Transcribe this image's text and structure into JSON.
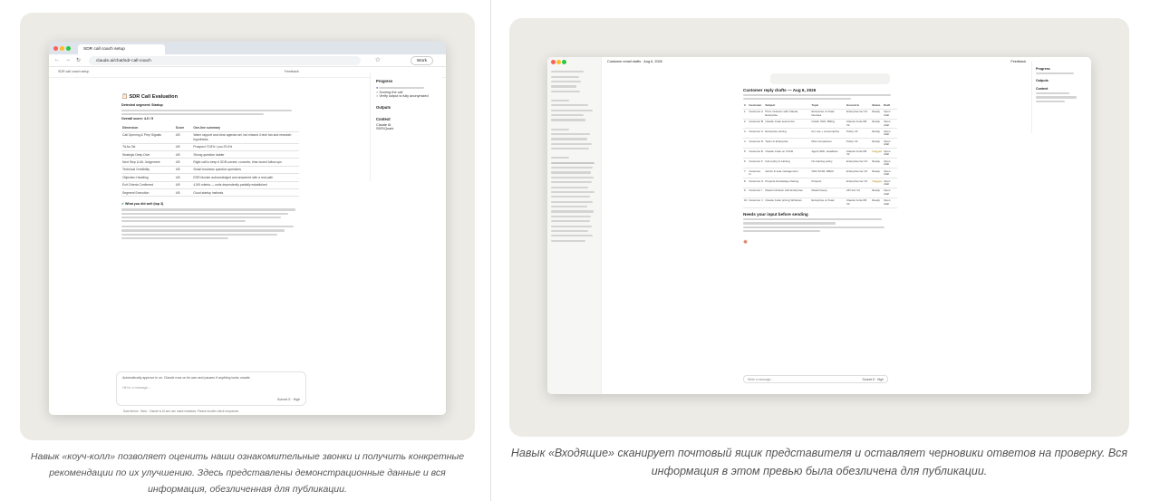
{
  "captions": {
    "left": "Навык «коуч-колл» позволяет оценить наши ознакомительные звонки и получить конкретные рекомендации по их улучшению. Здесь представлены демонстрационные данные и вся информация, обезличенная для публикации.",
    "right": "Навык «Входящие» сканирует почтовый ящик представителя и оставляет черновики ответов на проверку. Вся информация в этом превью была обезличена для публикации."
  },
  "left_shot": {
    "tab_title": "SDR call coach setup",
    "url": "claude.ai/chat/sdr-call-coach",
    "work_label": "Work",
    "toolbar_title": "SDR call coach setup",
    "feedback": "Feedback",
    "doc_title": "SDR Call Evaluation",
    "segment_line": "Detected segment: Startup",
    "overall": "Overall score: 4.0 / 5",
    "table_headers": [
      "Dimension",
      "Score",
      "One-line summary"
    ],
    "table_rows": [
      [
        "Call Opening & Prep Signals",
        "4/5",
        "Warm rapport and clear agenda set, but missed 4 tech fan and research hypothesis"
      ],
      [
        "Tit-for-Tat",
        "4/5",
        "Prospect 70.8% / you 29.4%"
      ],
      [
        "Strategic Deep Dive",
        "4/5",
        "Strong question ladder"
      ],
      [
        "Next Step & Alt. Judgement",
        "4/5",
        "Right call to keep it SDR-owned; concrete, time-boxed follow ups"
      ],
      [
        "Technical Credibility",
        "4/5",
        "Smart business question questions"
      ],
      [
        "Objection Handling",
        "4/5",
        "EDR blocker acknowledged and answered with a real path"
      ],
      [
        "Exit Criteria Confirmed",
        "4/5",
        "4.5/5 criteria — units dependently partially established"
      ],
      [
        "Segment Execution",
        "4/5",
        "Good startup instincts"
      ]
    ],
    "did_well": "What you did well (top 3)",
    "progress_title": "Progress",
    "progress_items": [
      "Scoring the call",
      "Verify output is fully anonymized"
    ],
    "outputs": "Outputs",
    "context": "Context",
    "context_items": [
      "Claude AI",
      "SDR/Quark"
    ],
    "notice": "Automatically approve is on. Claude runs on its own and pauses if anything looks unsafe.",
    "input_placeholder": "Hit for a message…",
    "model": "Sonnet 5 · High",
    "footer": [
      "Dark theme",
      "Beta",
      "Claude is AI and can make mistakes. Please double-check responses."
    ]
  },
  "right_shot": {
    "header_title": "Customer email drafts · Aug 6, 2026",
    "feedback": "Feedback",
    "section_title": "Customer reply drafts — Aug 6, 2026",
    "table_headers": [
      "#",
      "Customer",
      "Subject",
      "Topic",
      "Ground in",
      "Status",
      "Draft"
    ],
    "table_rows": [
      [
        "1",
        "Customer A",
        "Price inclusion with Claude Enterprise",
        "Enterprise vs Team licenses",
        "Enterprise tier V2",
        "Ready",
        "Open draft"
      ],
      [
        "2",
        "Customer B",
        "Claude Code seat terms",
        "Install, SSO, Billing",
        "Claude Code KB V2",
        "Ready",
        "Open draft"
      ],
      [
        "3",
        "Customer C",
        "Enterprise pricing",
        "For use + consumption",
        "Policy V2",
        "Ready",
        "Open draft"
      ],
      [
        "4",
        "Customer D",
        "Team to Enterprise",
        "Plan comparison",
        "Policy V2",
        "Ready",
        "Open draft"
      ],
      [
        "5",
        "Customer E",
        "Claude Code on CI/CD",
        "Agent SDK, Headless",
        "Claude Code KB V2",
        "Flagged",
        "Open draft"
      ],
      [
        "6",
        "Customer F",
        "Fair policy & training",
        "No training policy",
        "Enterprise tier V2",
        "Ready",
        "Open draft"
      ],
      [
        "7",
        "Customer G",
        "Admin & seat management",
        "SSO SCIM, RBAC",
        "Enterprise tier V2",
        "Ready",
        "Open draft"
      ],
      [
        "8",
        "Customer H",
        "Projects knowledge sharing",
        "Projects",
        "Enterprise tier V2",
        "Flagged",
        "Open draft"
      ],
      [
        "9",
        "Customer I",
        "Model inclusion with Enterprise",
        "Model lineup",
        "API doc V2",
        "Ready",
        "Open draft"
      ],
      [
        "10",
        "Customer J",
        "Claude Code pricing Windows",
        "Enterprise vs Team",
        "Claude Code KB V2",
        "Ready",
        "Open draft"
      ]
    ],
    "needs_input": "Needs your input before sending",
    "progress_title": "Progress",
    "outputs": "Outputs",
    "context": "Context",
    "input_placeholder": "Write a message…",
    "model": "Sonnet 5 · High"
  }
}
